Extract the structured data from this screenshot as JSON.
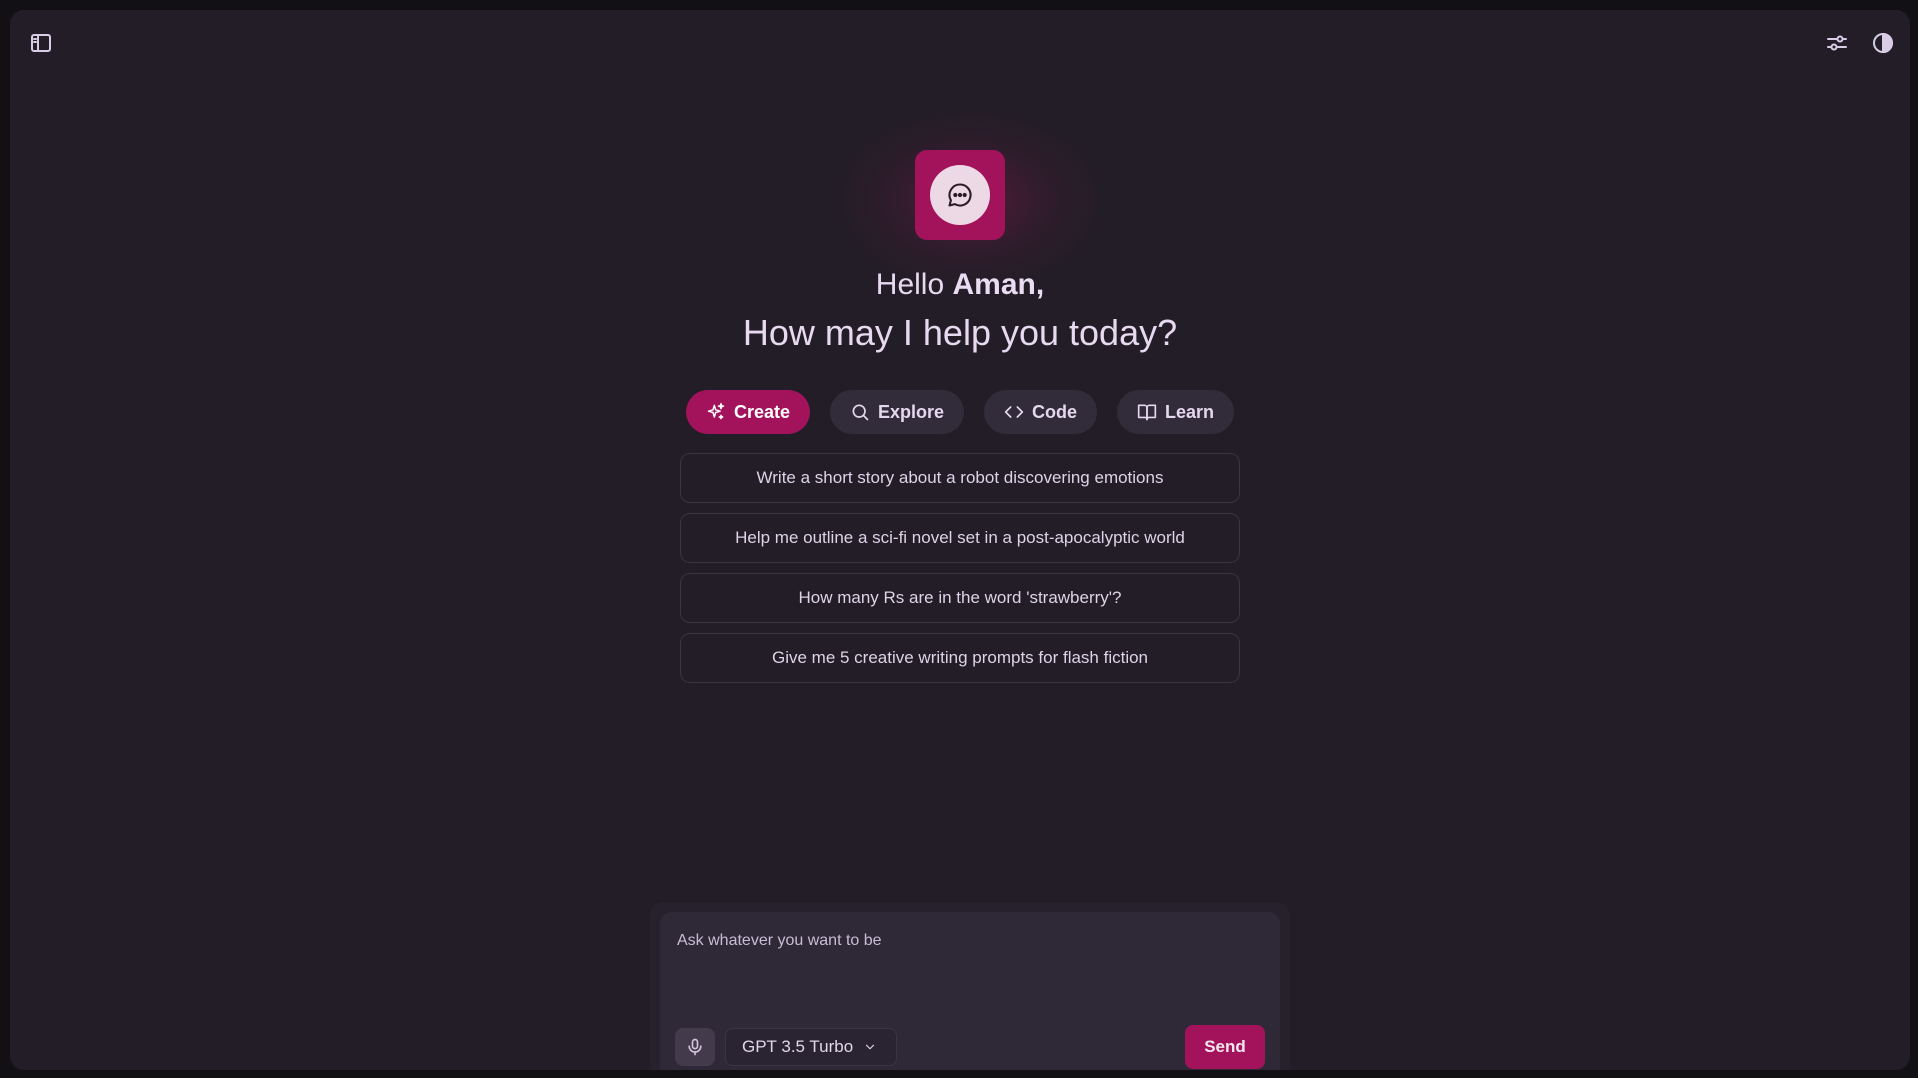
{
  "header": {
    "sidebar_toggle_icon": "sidebar-toggle-icon",
    "settings_icon": "sliders-icon",
    "theme_icon": "contrast-icon"
  },
  "hero": {
    "logo_icon": "chat-bubble-icon",
    "greeting_prefix": "Hello",
    "user_name": "Aman,",
    "question": "How may I help you today?"
  },
  "tabs": [
    {
      "label": "Create",
      "icon": "sparkles-icon",
      "active": true
    },
    {
      "label": "Explore",
      "icon": "search-icon",
      "active": false
    },
    {
      "label": "Code",
      "icon": "code-icon",
      "active": false
    },
    {
      "label": "Learn",
      "icon": "book-icon",
      "active": false
    }
  ],
  "suggestions": [
    "Write a short story about a robot discovering emotions",
    "Help me outline a sci-fi novel set in a post-apocalyptic world",
    "How many Rs are in the word 'strawberry'?",
    "Give me 5 creative writing prompts for flash fiction"
  ],
  "composer": {
    "placeholder": "Ask whatever you want to be",
    "value": "",
    "mic_icon": "microphone-icon",
    "model": "GPT 3.5 Turbo",
    "send_label": "Send"
  },
  "colors": {
    "accent": "#a3135c",
    "background": "#221d27",
    "surface": "#2f2837"
  }
}
